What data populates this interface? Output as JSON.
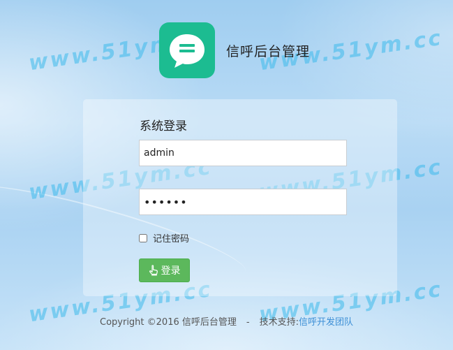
{
  "app": {
    "title": "信呼后台管理",
    "logo_icon": "chat-bubble-icon",
    "logo_color": "#1cbc91"
  },
  "watermark": "www.51ym.cc",
  "login": {
    "heading": "系统登录",
    "username_value": "admin",
    "password_value": "••••••",
    "remember_label": "记住密码",
    "remember_checked": false,
    "submit_label": "登录",
    "submit_icon": "hand-pointer-icon",
    "submit_color": "#5cb85c"
  },
  "footer": {
    "copyright": "Copyright ©2016 信呼后台管理",
    "separator": "-",
    "support_label": "技术支持:",
    "support_link": "信呼开发团队",
    "link_color": "#3d8fd6"
  }
}
